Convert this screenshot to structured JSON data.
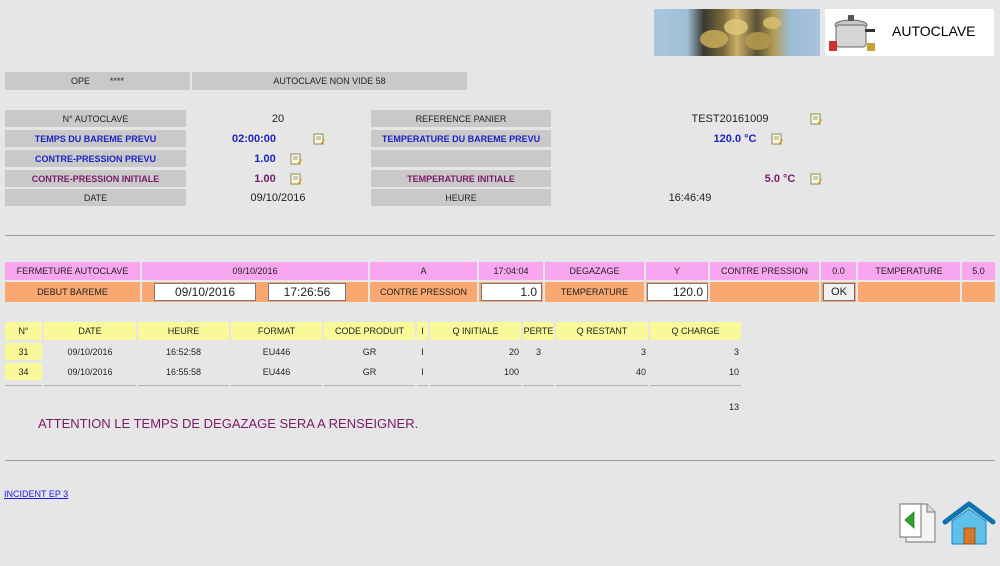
{
  "header": {
    "app_label": "AUTOCLAVE"
  },
  "ope": {
    "label": "OPE",
    "value": "****",
    "status": "AUTOCLAVE NON VIDE 58"
  },
  "info": {
    "num_autoclave_label": "N° AUTOCLAVE",
    "num_autoclave_value": "20",
    "ref_panier_label": "REFERENCE PANIER",
    "ref_panier_value": "TEST20161009",
    "temps_bareme_label": "TEMPS DU BAREME PREVU",
    "temps_bareme_value": "02:00:00",
    "temp_bareme_label": "TEMPERATURE DU BAREME PREVU",
    "temp_bareme_value": "120.0 °C",
    "contre_pression_prevu_label": "CONTRE-PRESSION PREVU",
    "contre_pression_prevu_value": "1.00",
    "contre_pression_init_label": "CONTRE-PRESSION INITIALE",
    "contre_pression_init_value": "1.00",
    "temp_initiale_label": "TEMPERATURE INITIALE",
    "temp_initiale_value": "5.0 °C",
    "date_label": "DATE",
    "date_value": "09/10/2016",
    "heure_label": "HEURE",
    "heure_value": "16:46:49"
  },
  "fermeture": {
    "label": "FERMETURE AUTOCLAVE",
    "date": "09/10/2016",
    "a_label": "A",
    "time": "17:04:04",
    "degazage_label": "DEGAZAGE",
    "degazage_value": "Y",
    "contre_pression_label": "CONTRE PRESSION",
    "contre_pression_value": "0.0",
    "temperature_label": "TEMPERATURE",
    "temperature_value": "5.0"
  },
  "debut": {
    "label": "DEBUT BAREME",
    "date_input": "09/10/2016",
    "time_input": "17:26:56",
    "contre_pression_label": "CONTRE PRESSION",
    "contre_pression_input": "1.0",
    "temperature_label": "TEMPERATURE",
    "temperature_input": "120.0",
    "ok_label": "OK"
  },
  "table": {
    "headers": [
      "N°",
      "DATE",
      "HEURE",
      "FORMAT",
      "CODE PRODUIT",
      "I",
      "Q INITIALE",
      "PERTE",
      "Q RESTANT",
      "Q CHARGE"
    ],
    "rows": [
      [
        "31",
        "09/10/2016",
        "16:52:58",
        "EU446",
        "GR",
        "I",
        "20",
        "3",
        "3",
        "3"
      ],
      [
        "34",
        "09/10/2016",
        "16:55:58",
        "EU446",
        "GR",
        "I",
        "100",
        "",
        "40",
        "10"
      ]
    ],
    "total": "13"
  },
  "warning": "ATTENTION LE TEMPS DE DEGAZAGE SERA A RENSEIGNER.",
  "incident_link": "INCIDENT EP 3",
  "icons": [
    "back-document-icon",
    "home-icon",
    "note-edit-icon",
    "pressure-cooker-icon"
  ]
}
